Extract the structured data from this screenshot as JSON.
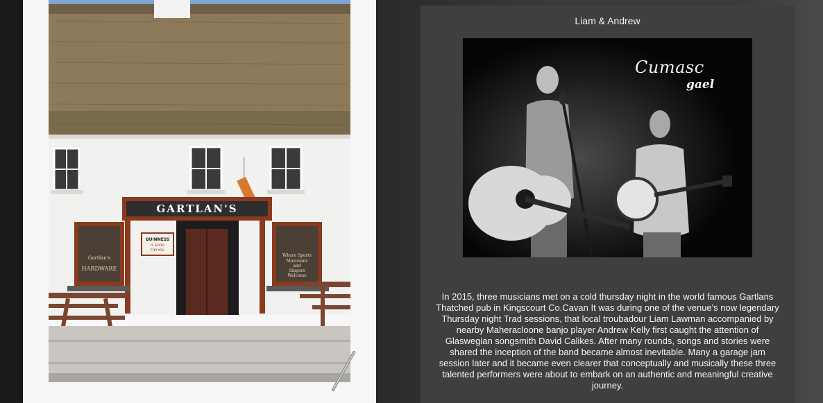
{
  "gallery": {
    "pub_sign": "GARTLAN'S",
    "guinness_sign": [
      "GUINNESS",
      "IS GOOD",
      "FOR YOU"
    ],
    "window_left_sign": [
      "Gartlan's",
      "HARDWARE"
    ],
    "window_right_sign": [
      "Where Sports",
      "Musicians",
      "and",
      "Singers",
      "Welcome"
    ]
  },
  "feature": {
    "title": "Liam & Andrew",
    "logo_line1": "Cumasc",
    "logo_line2": "gael",
    "description": "In 2015, three musicians met on a cold thursday night in the world famous Gartlans Thatched pub in Kingscourt Co.Cavan It was during one of the venue's now legendary Thursday night Trad sessions, that local troubadour Liam Lawman accompanied by nearby Maheracloone banjo player Andrew Kelly first caught the attention of Glaswegian songsmith David Calikes. After many rounds, songs and stories were shared the inception of the band became almost inevitable. Many a garage jam session later and it became even clearer that conceptually and musically these three talented performers were about to embark on an authentic and meaningful creative journey."
  },
  "colors": {
    "page_bg": "#1c1c1c",
    "panel_bg": "#3f3f3f",
    "polaroid_frame": "#f7f7f7",
    "pub_trim": "#8a3a1e"
  }
}
